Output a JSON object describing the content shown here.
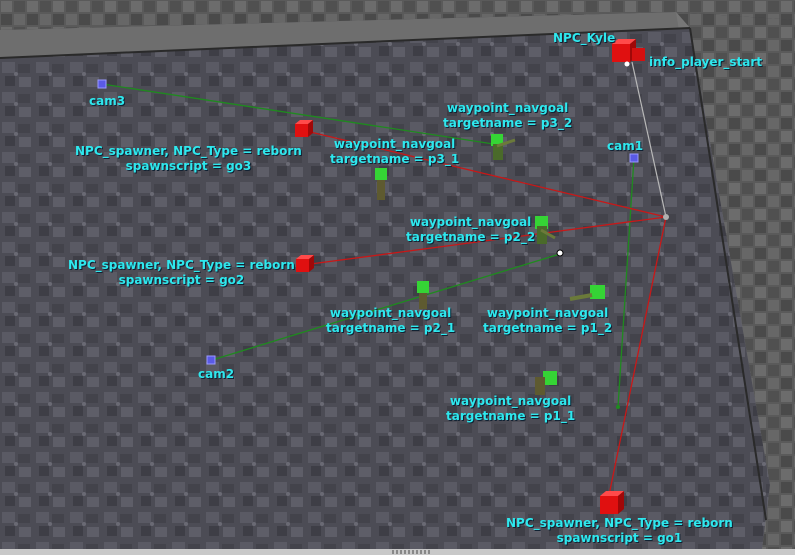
{
  "colors": {
    "label": "#2ee8ee",
    "npc_entity": "#e01010",
    "waypoint_entity": "#35d435",
    "camera_entity": "#5a5ae6",
    "npc_link": "#c81818",
    "camera_link": "#1f8a1f",
    "start_link": "#b8b8b8"
  },
  "entities": {
    "npc_kyle": {
      "label": "NPC_Kyle",
      "icon": "npc-red-cube"
    },
    "info_player_start": {
      "label": "info_player_start",
      "icon": "player-start-marker"
    },
    "cam1": {
      "label": "cam1",
      "icon": "camera-cube"
    },
    "cam2": {
      "label": "cam2",
      "icon": "camera-cube"
    },
    "cam3": {
      "label": "cam3",
      "icon": "camera-cube"
    },
    "spawner_go3": {
      "line1": "NPC_spawner, NPC_Type = reborn",
      "line2": "spawnscript = go3"
    },
    "spawner_go2": {
      "line1": "NPC_spawner, NPC_Type = reborn",
      "line2": "spawnscript = go2"
    },
    "spawner_go1": {
      "line1": "NPC_spawner, NPC_Type = reborn",
      "line2": "spawnscript = go1"
    },
    "wp_p3_2": {
      "line1": "waypoint_navgoal",
      "line2": "targetname = p3_2"
    },
    "wp_p3_1": {
      "line1": "waypoint_navgoal",
      "line2": "targetname = p3_1"
    },
    "wp_p2_2": {
      "line1": "waypoint_navgoal",
      "line2": "targetname = p2_2"
    },
    "wp_p2_1": {
      "line1": "waypoint_navgoal",
      "line2": "targetname = p2_1"
    },
    "wp_p1_2": {
      "line1": "waypoint_navgoal",
      "line2": "targetname = p1_2"
    },
    "wp_p1_1": {
      "line1": "waypoint_navgoal",
      "line2": "targetname = p1_1"
    }
  }
}
